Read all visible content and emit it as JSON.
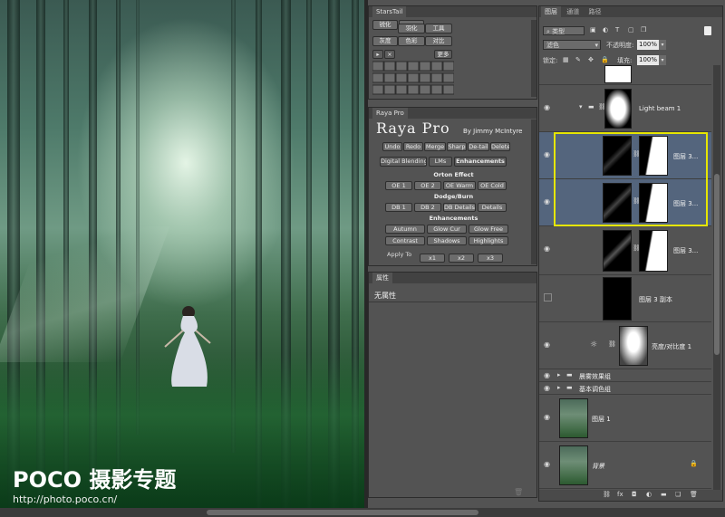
{
  "watermark": {
    "brand": "POCO 摄影专题",
    "url": "http://photo.poco.cn/"
  },
  "starstail": {
    "title": "StarsTail",
    "row1": [
      "锐化",
      "羽化",
      "工具"
    ],
    "row2": [
      "灰度",
      "色彩",
      "对比"
    ],
    "more": "更多"
  },
  "raya": {
    "tab": "Raya Pro",
    "logo": "Raya Pro",
    "byline": "By Jimmy McIntyre",
    "top_buttons": [
      "Undo",
      "Redo",
      "Merge",
      "Sharp",
      "De-tail",
      "Delete"
    ],
    "tabs": [
      "Digital Blending",
      "LMs",
      "Enhancements"
    ],
    "orton_label": "Orton Effect",
    "orton": [
      "OE 1",
      "OE 2",
      "OE Warm",
      "OE Cold"
    ],
    "dodge_label": "Dodge/Burn",
    "dodge": [
      "DB 1",
      "DB 2",
      "DB Details",
      "Details"
    ],
    "enh_label": "Enhancements",
    "enh1": [
      "Autumn",
      "Glow Cur",
      "Glow Free"
    ],
    "enh2": [
      "Contrast",
      "Shadows",
      "Highlights"
    ],
    "apply_to": "Apply To",
    "apply": [
      "x1",
      "x2",
      "x3"
    ]
  },
  "properties": {
    "title": "属性",
    "empty": "无属性"
  },
  "layers_panel": {
    "tabs": [
      "图层",
      "通道",
      "路径"
    ],
    "filter": "类型",
    "blend_mode": "滤色",
    "opacity_label": "不透明度:",
    "opacity": "100%",
    "lock_label": "锁定:",
    "fill_label": "填充:",
    "fill": "100%",
    "layers": [
      {
        "name": "Light beam 1"
      },
      {
        "name": "图层 3..."
      },
      {
        "name": "图层 3..."
      },
      {
        "name": "图层 3..."
      },
      {
        "name": "图层 3 副本"
      },
      {
        "name": "亮度/对比度 1"
      },
      {
        "name": "晨雾效果组"
      },
      {
        "name": "基本调色组"
      },
      {
        "name": "图层 1"
      },
      {
        "name": "背景"
      }
    ]
  },
  "colors": {
    "selection": "#54657d",
    "highlight_box": "#e6e600",
    "panel_bg": "#535353"
  }
}
